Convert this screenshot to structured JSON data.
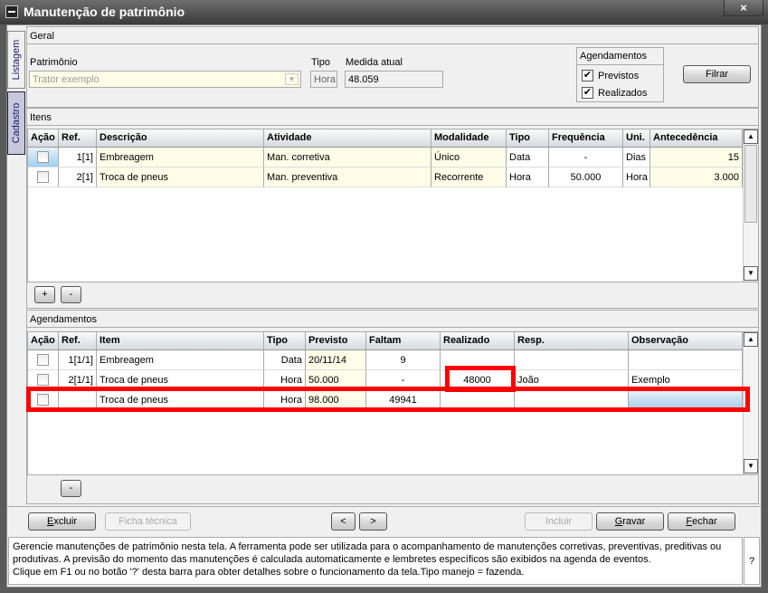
{
  "window": {
    "title": "Manutenção de patrimônio",
    "close_icon": "×"
  },
  "side_tabs": [
    {
      "label": "Listagem"
    },
    {
      "label": "Cadastro"
    }
  ],
  "geral": {
    "section": "Geral",
    "patrimonio_label": "Patrimônio",
    "patrimonio_value": "Trator exemplo",
    "tipo_label": "Tipo",
    "tipo_value": "Hora",
    "medida_label": "Medida atual",
    "medida_value": "48.059",
    "agendamentos_group": "Agendamentos",
    "previstos": "Previstos",
    "realizados": "Realizados",
    "previstos_checked": true,
    "realizados_checked": true,
    "filter_button": "Filrar"
  },
  "itens": {
    "section": "Itens",
    "columns": [
      "Ação",
      "Ref.",
      "Descrição",
      "Atividade",
      "Modalidade",
      "Tipo",
      "Frequência",
      "Uni.",
      "Antecedência"
    ],
    "rows": [
      [
        "",
        "1[1]",
        "Embreagem",
        "Man. corretiva",
        "Único",
        "Data",
        "-",
        "Dias",
        "15"
      ],
      [
        "",
        "2[1]",
        "Troca de pneus",
        "Man. preventiva",
        "Recorrente",
        "Hora",
        "50.000",
        "Hora",
        "3.000"
      ]
    ],
    "add_button": "+",
    "remove_button": "-"
  },
  "agendamentos": {
    "section": "Agendamentos",
    "columns": [
      "Ação",
      "Ref.",
      "Item",
      "Tipo",
      "Previsto",
      "Faltam",
      "Realizado",
      "Resp.",
      "Observação"
    ],
    "rows": [
      [
        "",
        "1[1/1]",
        "Embreagem",
        "Data",
        "20/11/14",
        "9",
        "",
        "",
        ""
      ],
      [
        "",
        "2[1/1]",
        "Troca de pneus",
        "Hora",
        "50.000",
        "-",
        "48000",
        "João",
        "Exemplo"
      ],
      [
        "",
        "",
        "Troca de pneus",
        "Hora",
        "98.000",
        "49941",
        "",
        "",
        ""
      ]
    ],
    "remove_button": "-"
  },
  "footer": {
    "excluir": "Excluir",
    "ficha": "Ficha técnica",
    "prev": "<",
    "next": ">",
    "incluir": "Incluir",
    "gravar": "Gravar",
    "fechar": "Fechar"
  },
  "info": {
    "line1": "Gerencie manutenções de patrimônio nesta tela. A ferramenta pode ser utilizada para o acompanhamento de manutenções corretivas, preventivas, preditivas ou",
    "line2": "produtivas. A previsão do momento das manutenções é calculada automaticamente e lembretes específicos são exibidos na agenda de eventos.",
    "line3": "Clique em F1 ou no botão '?' desta barra para obter detalhes sobre o funcionamento da tela.Tipo manejo = fazenda.",
    "help": "?"
  },
  "colors": {
    "highlight": "#ff0000",
    "yellow_cell": "#fffde8",
    "title_bar": "#3a3a3a"
  }
}
